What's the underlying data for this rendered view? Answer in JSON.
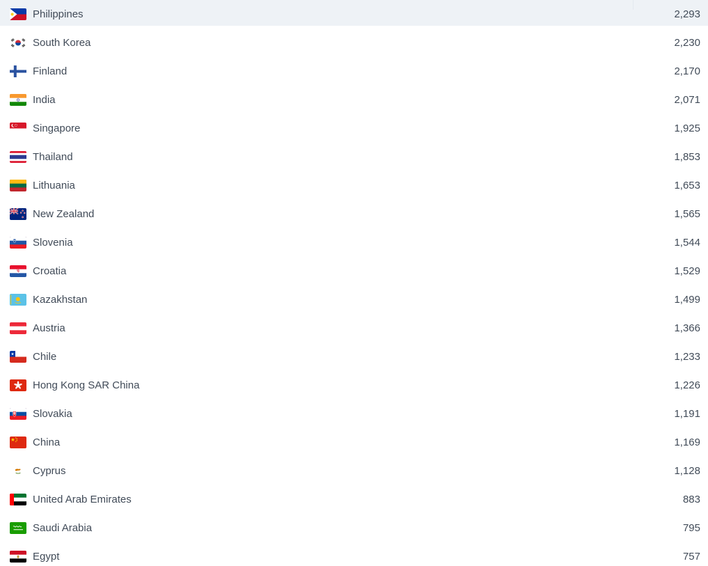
{
  "colors": {
    "row_highlight": "#eef2f6",
    "text": "#414b58",
    "background": "#ffffff"
  },
  "list": {
    "rows": [
      {
        "country": "Philippines",
        "value": "2,293",
        "flag": "philippines-flag"
      },
      {
        "country": "South Korea",
        "value": "2,230",
        "flag": "south-korea-flag"
      },
      {
        "country": "Finland",
        "value": "2,170",
        "flag": "finland-flag"
      },
      {
        "country": "India",
        "value": "2,071",
        "flag": "india-flag"
      },
      {
        "country": "Singapore",
        "value": "1,925",
        "flag": "singapore-flag"
      },
      {
        "country": "Thailand",
        "value": "1,853",
        "flag": "thailand-flag"
      },
      {
        "country": "Lithuania",
        "value": "1,653",
        "flag": "lithuania-flag"
      },
      {
        "country": "New Zealand",
        "value": "1,565",
        "flag": "new-zealand-flag"
      },
      {
        "country": "Slovenia",
        "value": "1,544",
        "flag": "slovenia-flag"
      },
      {
        "country": "Croatia",
        "value": "1,529",
        "flag": "croatia-flag"
      },
      {
        "country": "Kazakhstan",
        "value": "1,499",
        "flag": "kazakhstan-flag"
      },
      {
        "country": "Austria",
        "value": "1,366",
        "flag": "austria-flag"
      },
      {
        "country": "Chile",
        "value": "1,233",
        "flag": "chile-flag"
      },
      {
        "country": "Hong Kong SAR China",
        "value": "1,226",
        "flag": "hong-kong-flag"
      },
      {
        "country": "Slovakia",
        "value": "1,191",
        "flag": "slovakia-flag"
      },
      {
        "country": "China",
        "value": "1,169",
        "flag": "china-flag"
      },
      {
        "country": "Cyprus",
        "value": "1,128",
        "flag": "cyprus-flag"
      },
      {
        "country": "United Arab Emirates",
        "value": "883",
        "flag": "united-arab-emirates-flag"
      },
      {
        "country": "Saudi Arabia",
        "value": "795",
        "flag": "saudi-arabia-flag"
      },
      {
        "country": "Egypt",
        "value": "757",
        "flag": "egypt-flag"
      }
    ]
  }
}
